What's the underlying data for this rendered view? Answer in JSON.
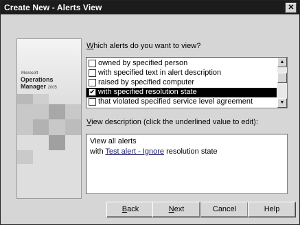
{
  "window": {
    "title": "Create New - Alerts View",
    "close_glyph": "✕"
  },
  "brand": {
    "ms": "Microsoft",
    "line1": "Operations",
    "line2": "Manager",
    "year": "2005"
  },
  "alerts_question": {
    "accel": "W",
    "rest": "hich alerts do you want to view?"
  },
  "alerts_list": {
    "items": [
      {
        "label": "owned by specified person",
        "checked": false,
        "selected": false
      },
      {
        "label": "with specified text in alert description",
        "checked": false,
        "selected": false
      },
      {
        "label": "raised by specified computer",
        "checked": false,
        "selected": false
      },
      {
        "label": "with specified resolution state",
        "checked": true,
        "selected": true
      },
      {
        "label": "that violated specified service level agreement",
        "checked": false,
        "selected": false
      }
    ]
  },
  "view_description": {
    "label_accel": "V",
    "label_rest": "iew description (click the underlined value to edit):",
    "line1": "View all alerts",
    "line2_prefix": "with ",
    "line2_link": "Test alert - Ignore",
    "line2_suffix": " resolution state"
  },
  "buttons": {
    "back_accel": "B",
    "back_rest": "ack",
    "next_accel": "N",
    "next_rest": "ext",
    "cancel": "Cancel",
    "help": "Help"
  }
}
